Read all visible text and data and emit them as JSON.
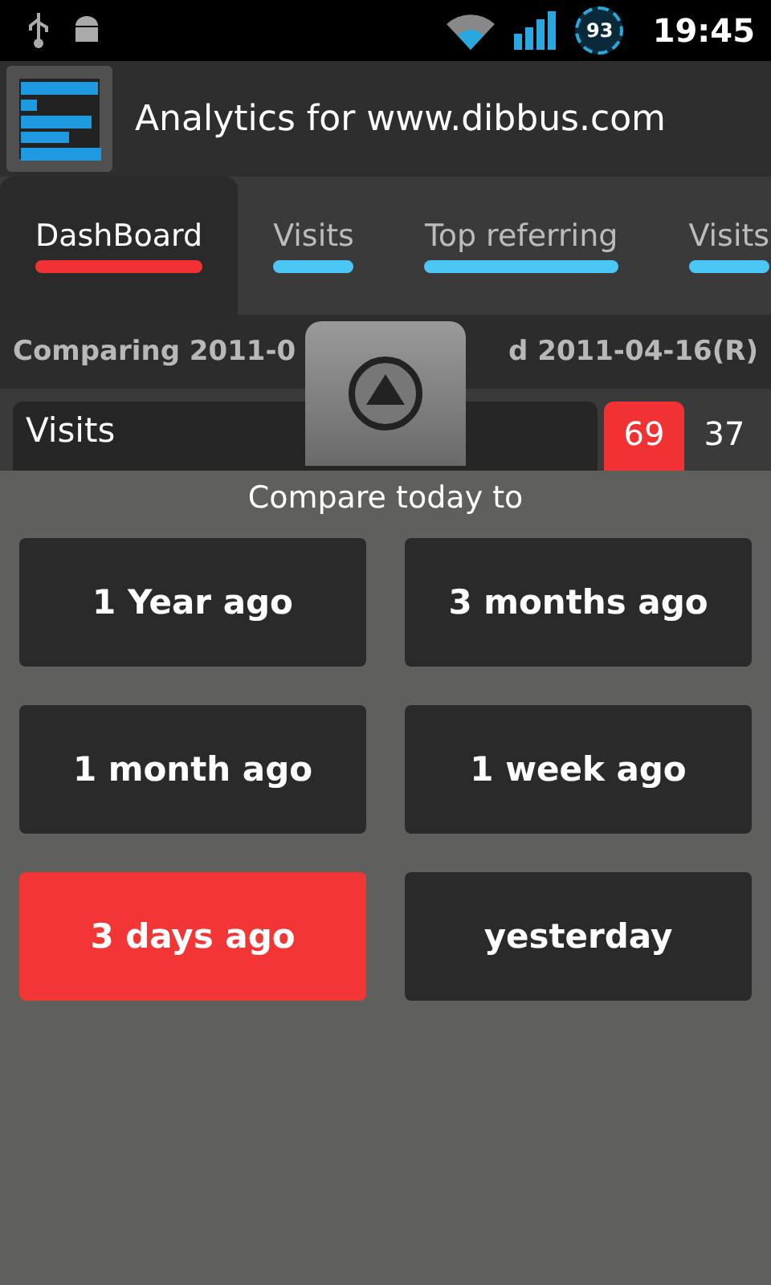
{
  "status_bar": {
    "battery": "93",
    "time": "19:45"
  },
  "app_bar": {
    "title": "Analytics for www.dibbus.com"
  },
  "tabs": [
    {
      "label": "DashBoard",
      "selected": true
    },
    {
      "label": "Visits",
      "selected": false
    },
    {
      "label": "Top referring",
      "selected": false
    },
    {
      "label": "Visits",
      "selected": false
    }
  ],
  "comparing": {
    "left": "Comparing 2011-0",
    "right": "d 2011-04-16(R)"
  },
  "metric_row": {
    "label": "Visits",
    "current": "69",
    "previous": "37"
  },
  "drawer": {
    "title": "Compare today to",
    "options": [
      {
        "label": "1 Year ago",
        "selected": false
      },
      {
        "label": "3 months ago",
        "selected": false
      },
      {
        "label": "1 month ago",
        "selected": false
      },
      {
        "label": "1 week ago",
        "selected": false
      },
      {
        "label": "3 days ago",
        "selected": true
      },
      {
        "label": "yesterday",
        "selected": false
      }
    ]
  }
}
